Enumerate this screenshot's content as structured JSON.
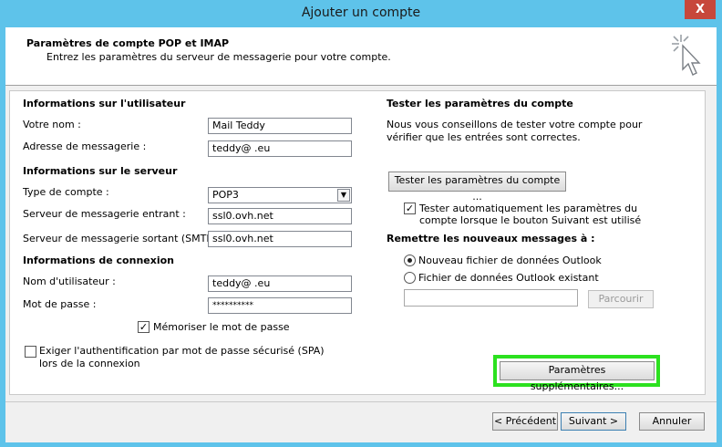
{
  "window": {
    "title": "Ajouter un compte",
    "close": "X"
  },
  "header": {
    "title": "Paramètres de compte POP et IMAP",
    "subtitle": "Entrez les paramètres du serveur de messagerie pour votre compte."
  },
  "user_info": {
    "section": "Informations sur l'utilisateur",
    "name_label": "Votre nom :",
    "name_value": "Mail Teddy",
    "email_label": "Adresse de messagerie :",
    "email_value": "teddy@            .eu"
  },
  "server_info": {
    "section": "Informations sur le serveur",
    "type_label": "Type de compte :",
    "type_value": "POP3",
    "incoming_label": "Serveur de messagerie entrant :",
    "incoming_value": "ssl0.ovh.net",
    "outgoing_label": "Serveur de messagerie sortant (SMTP) :",
    "outgoing_value": "ssl0.ovh.net"
  },
  "login_info": {
    "section": "Informations de connexion",
    "username_label": "Nom d'utilisateur :",
    "username_value": "teddy@            .eu",
    "password_label": "Mot de passe :",
    "password_value": "**********",
    "remember_label": "Mémoriser le mot de passe",
    "remember_checked": true,
    "spa_label_line1": "Exiger l'authentification par mot de passe sécurisé (SPA)",
    "spa_label_line2": "lors de la connexion",
    "spa_checked": false
  },
  "test": {
    "section": "Tester les paramètres du compte",
    "desc_line1": "Nous vous conseillons de tester votre compte pour",
    "desc_line2": "vérifier que les entrées sont correctes.",
    "test_button": "Tester les paramètres du compte ...",
    "auto_test_line1": "Tester automatiquement les paramètres du",
    "auto_test_line2": "compte lorsque le bouton Suivant est utilisé",
    "auto_test_checked": true
  },
  "deliver": {
    "section": "Remettre les nouveaux messages à :",
    "option_new": "Nouveau fichier de données Outlook",
    "option_existing": "Fichier de données Outlook existant",
    "selected": "new",
    "path_value": "",
    "browse_button": "Parcourir"
  },
  "more_settings_button": "Paramètres supplémentaires...",
  "footer": {
    "back_button": "< Précédent",
    "next_button": "Suivant >",
    "cancel_button": "Annuler"
  },
  "colors": {
    "titlebar": "#5ec3ea",
    "close": "#c7473b",
    "highlight": "#2ce11f"
  },
  "icons": {
    "wizard": "wizard-cursor-sparkle-icon",
    "check": "checkmark-icon",
    "dropdown": "chevron-down-icon"
  }
}
